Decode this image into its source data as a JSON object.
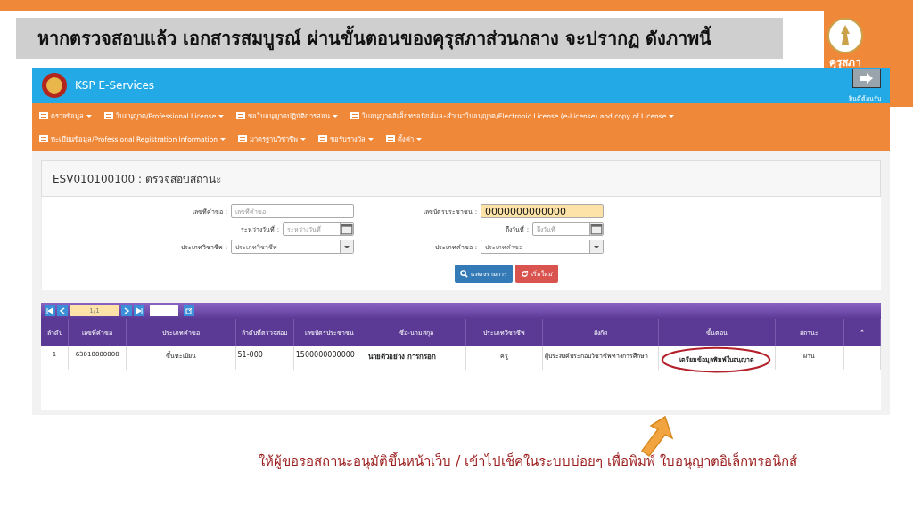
{
  "slide": {
    "title": "หากตรวจสอบแล้ว เอกสารสมบูรณ์ ผ่านขั้นตอนของคุรุสภาส่วนกลาง จะปรากฏ ดังภาพนี้",
    "logo_text": "คุรุสภา",
    "caption": "ให้ผู้ขอรอสถานะอนุมัติขึ้นหน้าเว็บ / เข้าไปเช็คในระบบบ่อยๆ เพื่อพิมพ์ ใบอนุญาตอิเล็กทรอนิกส์"
  },
  "app": {
    "brand": "KSP E-Services",
    "welcome": "ยินดีต้อนรับ",
    "menu": [
      {
        "label": "ตรวจข้อมูล"
      },
      {
        "label": "ใบอนุญาต/Professional License"
      },
      {
        "label": "ขอใบอนุญาตปฏิบัติการสอน"
      },
      {
        "label": "ใบอนุญาตอิเล็กทรอนิกส์และสำเนาใบอนุญาต/Electronic License (e-License) and copy of License"
      },
      {
        "label": "ทะเบียนข้อมูล/Professional Registration Information"
      },
      {
        "label": "มาตรฐานวิชาชีพ"
      },
      {
        "label": "ขอรับรางวัล"
      },
      {
        "label": "ตั้งค่า"
      }
    ],
    "page_title": "ESV010100100 : ตรวจสอบสถานะ",
    "fields": [
      {
        "label": "เลขที่คำขอ :",
        "kind": "text",
        "placeholder": "เลขที่คำขอ",
        "highlighted": false
      },
      {
        "label": "เลขบัตรประชาชน :",
        "kind": "text",
        "value": "0000000000000",
        "highlighted": true
      },
      {
        "label": "ระหว่างวันที่ :",
        "kind": "date",
        "placeholder": "ระหว่างวันที่",
        "highlighted": false
      },
      {
        "label": "ถึงวันที่ :",
        "kind": "date",
        "placeholder": "ถึงวันที่",
        "highlighted": false
      },
      {
        "label": "ประเภทวิชาชีพ :",
        "kind": "select",
        "placeholder": "ประเภทวิชาชีพ",
        "highlighted": false
      },
      {
        "label": "ประเภทคำขอ :",
        "kind": "select",
        "placeholder": "ประเภทคำขอ",
        "highlighted": false
      }
    ],
    "buttons": [
      {
        "label": "แสดงรายการ",
        "kind": "primary"
      },
      {
        "label": "เริ่มใหม่",
        "kind": "danger"
      }
    ],
    "pager": {
      "page": "1/1"
    },
    "table": {
      "columns": [
        "ลำดับ",
        "เลขที่คำขอ",
        "ประเภทคำขอ",
        "ลำดับที่ตรวจสอบ",
        "เลขบัตรประชาชน",
        "ชื่อ-นามสกุล",
        "ประเภทวิชาชีพ",
        "สังกัด",
        "ขั้นตอน",
        "สถานะ",
        "*"
      ],
      "rows": [
        {
          "cells": [
            {
              "text": "1",
              "circled": false
            },
            {
              "text": "63010000000",
              "circled": false
            },
            {
              "text": "ขึ้นทะเบียน",
              "circled": false
            },
            {
              "text": "51-000",
              "circled": false
            },
            {
              "text": "1500000000000",
              "circled": false
            },
            {
              "text": "นายตัวอย่าง การกรอก",
              "circled": false
            },
            {
              "text": "ครู",
              "circled": false
            },
            {
              "text": "ผู้ประสงค์ประกอบวิชาชีพทางการศึกษา",
              "circled": false
            },
            {
              "text": "เตรียมข้อมูลพิมพ์ใบอนุญาต",
              "circled": true
            },
            {
              "text": "ผ่าน",
              "circled": false
            }
          ]
        }
      ]
    }
  }
}
